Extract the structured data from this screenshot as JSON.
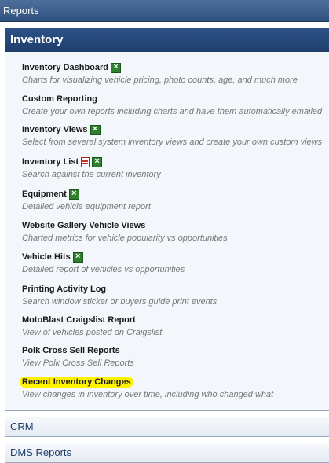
{
  "window": {
    "title": "Reports"
  },
  "inventory": {
    "header": "Inventory",
    "reports": [
      {
        "title": "Inventory Dashboard",
        "description": "Charts for visualizing vehicle pricing, photo counts, age, and much more",
        "icons": [
          "excel-icon"
        ]
      },
      {
        "title": "Custom Reporting",
        "description": "Create your own reports including charts and have them automatically emailed",
        "icons": []
      },
      {
        "title": "Inventory Views",
        "description": "Select from several system inventory views and create your own custom views",
        "icons": [
          "excel-icon"
        ]
      },
      {
        "title": "Inventory List",
        "description": "Search against the current inventory",
        "icons": [
          "pdf-icon",
          "excel-icon"
        ]
      },
      {
        "title": "Equipment",
        "description": "Detailed vehicle equipment report",
        "icons": [
          "excel-icon"
        ]
      },
      {
        "title": "Website Gallery Vehicle Views",
        "description": "Charted metrics for vehicle popularity vs opportunities",
        "icons": []
      },
      {
        "title": "Vehicle Hits",
        "description": "Detailed report of vehicles vs opportunities",
        "icons": [
          "excel-icon"
        ]
      },
      {
        "title": "Printing Activity Log",
        "description": "Search window sticker or buyers guide print events",
        "icons": []
      },
      {
        "title": "MotoBlast Craigslist Report",
        "description": "View of vehicles posted on Craigslist",
        "icons": []
      },
      {
        "title": "Polk Cross Sell Reports",
        "description": "View Polk Cross Sell Reports",
        "icons": []
      },
      {
        "title": "Recent Inventory Changes",
        "description": "View changes in inventory over time, including who changed what",
        "icons": [],
        "highlighted": true,
        "highlight_color": "#fff200"
      }
    ]
  },
  "sections": [
    {
      "label": "CRM"
    },
    {
      "label": "DMS Reports"
    }
  ],
  "colors": {
    "header_blue": "#1f3e6c",
    "title_bar": "#2f4f7d",
    "highlight": "#fff200",
    "excel_green": "#2f7f2f",
    "pdf_red": "#d32f2f"
  }
}
